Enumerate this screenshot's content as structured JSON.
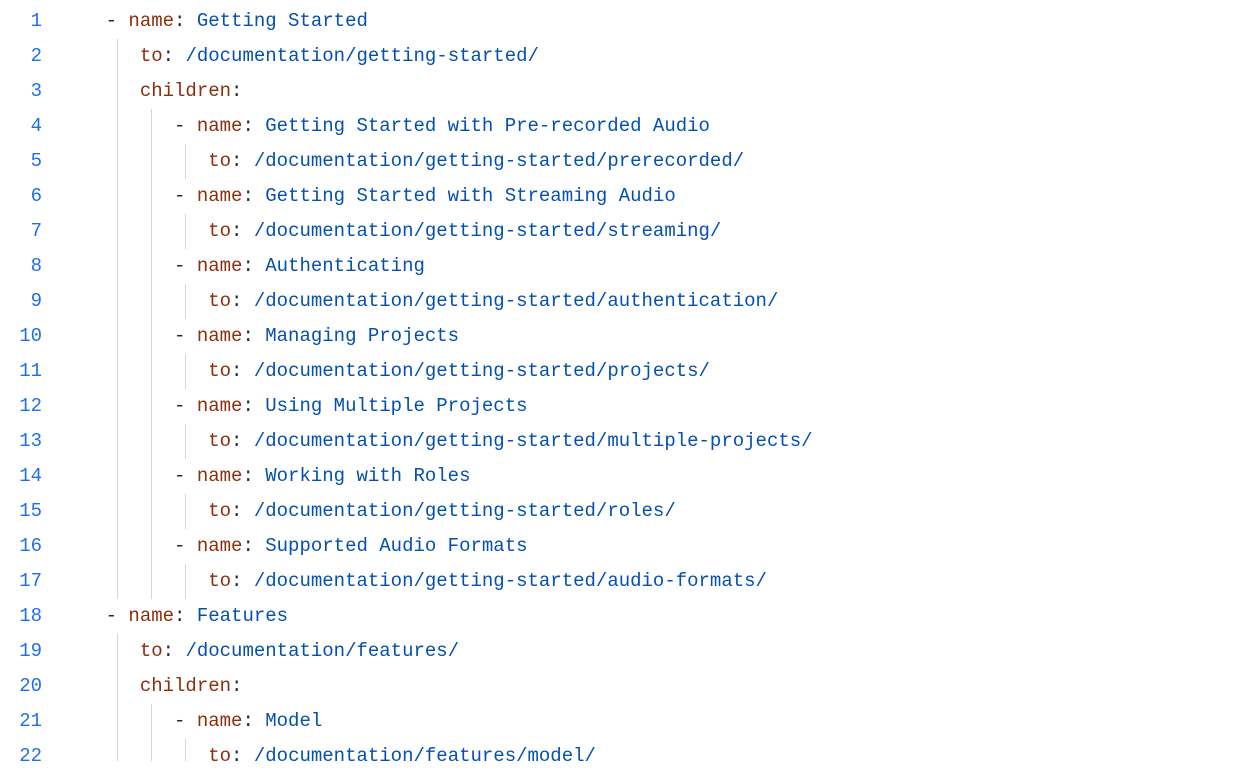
{
  "colors": {
    "lineNumber": "#1f6feb",
    "key": "#8c2e0b",
    "value": "#0550ae",
    "guide": "#d0d7de",
    "text": "#24292f"
  },
  "indentUnitCh": 2,
  "guideBaseCh": 5,
  "lines": [
    {
      "num": 1,
      "indent": 0,
      "dash": true,
      "key": "name",
      "value": "Getting Started"
    },
    {
      "num": 2,
      "indent": 1,
      "dash": false,
      "key": "to",
      "value": "/documentation/getting-started/"
    },
    {
      "num": 3,
      "indent": 1,
      "dash": false,
      "key": "children",
      "value": ""
    },
    {
      "num": 4,
      "indent": 2,
      "dash": true,
      "key": "name",
      "value": "Getting Started with Pre-recorded Audio"
    },
    {
      "num": 5,
      "indent": 3,
      "dash": false,
      "key": "to",
      "value": "/documentation/getting-started/prerecorded/"
    },
    {
      "num": 6,
      "indent": 2,
      "dash": true,
      "key": "name",
      "value": "Getting Started with Streaming Audio"
    },
    {
      "num": 7,
      "indent": 3,
      "dash": false,
      "key": "to",
      "value": "/documentation/getting-started/streaming/"
    },
    {
      "num": 8,
      "indent": 2,
      "dash": true,
      "key": "name",
      "value": "Authenticating"
    },
    {
      "num": 9,
      "indent": 3,
      "dash": false,
      "key": "to",
      "value": "/documentation/getting-started/authentication/"
    },
    {
      "num": 10,
      "indent": 2,
      "dash": true,
      "key": "name",
      "value": "Managing Projects"
    },
    {
      "num": 11,
      "indent": 3,
      "dash": false,
      "key": "to",
      "value": "/documentation/getting-started/projects/"
    },
    {
      "num": 12,
      "indent": 2,
      "dash": true,
      "key": "name",
      "value": "Using Multiple Projects"
    },
    {
      "num": 13,
      "indent": 3,
      "dash": false,
      "key": "to",
      "value": "/documentation/getting-started/multiple-projects/"
    },
    {
      "num": 14,
      "indent": 2,
      "dash": true,
      "key": "name",
      "value": "Working with Roles"
    },
    {
      "num": 15,
      "indent": 3,
      "dash": false,
      "key": "to",
      "value": "/documentation/getting-started/roles/"
    },
    {
      "num": 16,
      "indent": 2,
      "dash": true,
      "key": "name",
      "value": "Supported Audio Formats"
    },
    {
      "num": 17,
      "indent": 3,
      "dash": false,
      "key": "to",
      "value": "/documentation/getting-started/audio-formats/"
    },
    {
      "num": 18,
      "indent": 0,
      "dash": true,
      "key": "name",
      "value": "Features"
    },
    {
      "num": 19,
      "indent": 1,
      "dash": false,
      "key": "to",
      "value": "/documentation/features/"
    },
    {
      "num": 20,
      "indent": 1,
      "dash": false,
      "key": "children",
      "value": ""
    },
    {
      "num": 21,
      "indent": 2,
      "dash": true,
      "key": "name",
      "value": "Model"
    },
    {
      "num": 22,
      "indent": 3,
      "dash": false,
      "key": "to",
      "value": "/documentation/features/model/",
      "truncated": true
    }
  ]
}
